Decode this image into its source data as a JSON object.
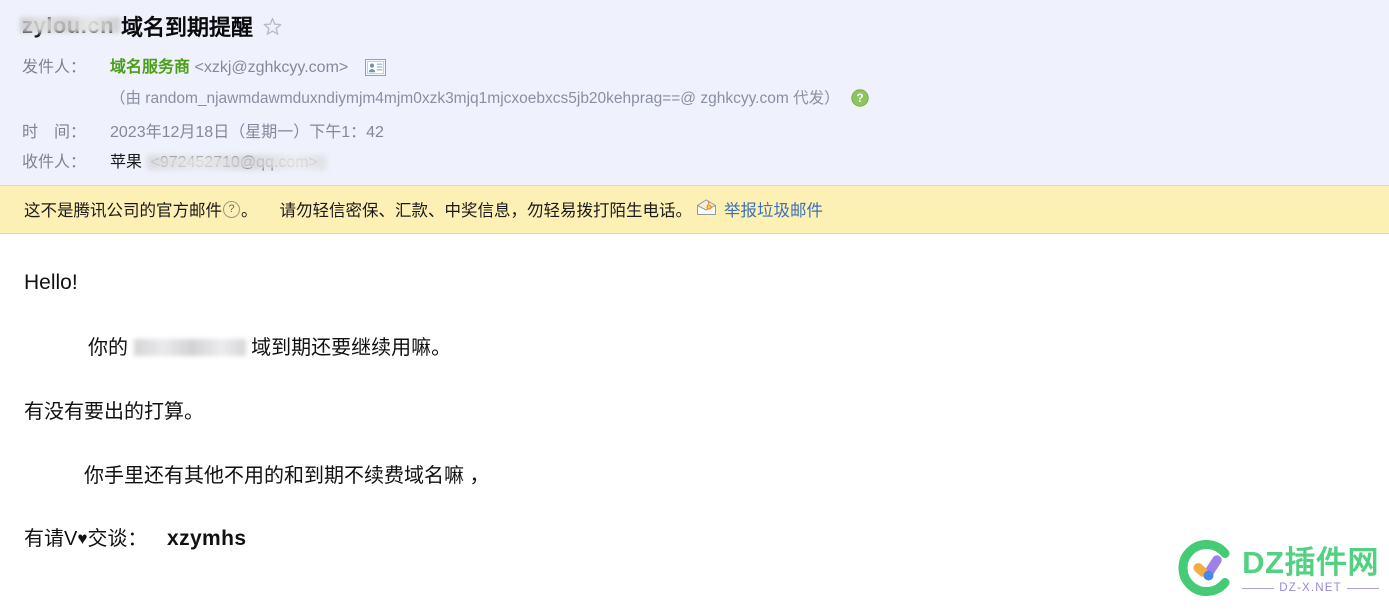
{
  "header": {
    "subject_redacted": "zylou.cn",
    "subject_text": "域名到期提醒",
    "star_icon": "star-outline-icon",
    "labels": {
      "from": "发件人：",
      "time": "时　间：",
      "to": "收件人："
    },
    "sender": {
      "display_name": "域名服务商",
      "address": "<xzkj@zghkcyy.com>",
      "contact_icon": "contact-card-icon"
    },
    "delegate": {
      "text": "（由 random_njawmdawmduxndiymjm4mjm0xzk3mjq1mjcxoebxcs5jb20kehprag==@ zghkcyy.com 代发）",
      "help_icon": "green-question-help-icon"
    },
    "time_value": "2023年12月18日（星期一）下午1：42",
    "recipient": {
      "name": "苹果",
      "address_redacted": "<972452710@qq.com>"
    }
  },
  "warning": {
    "text_before_q": "这不是腾讯公司的官方邮件",
    "q_mark": "?",
    "text_after_q": "。",
    "advice": "请勿轻信密保、汇款、中奖信息，勿轻易拨打陌生电话。",
    "spam_icon": "spam-mail-flame-icon",
    "report_link": "举报垃圾邮件"
  },
  "body": {
    "greeting": "Hello!",
    "line1_prefix": "你的",
    "line1_redacted": "zylou.cn",
    "line1_suffix": "域到期还要继续用嘛。",
    "line2": "有没有要出的打算。",
    "line3": "你手里还有其他不用的和到期不续费域名嘛 ，",
    "line4_prefix": "有请V",
    "line4_heart": "♥",
    "line4_mid": "交谈：",
    "wechat_id": "xzymhs"
  },
  "watermark": {
    "title": "DZ插件网",
    "subtitle": "DZ-X.NET",
    "logo_icon": "dz-check-circle-logo"
  },
  "colors": {
    "header_bg": "#eff2fd",
    "banner_bg": "#fdf0b4",
    "banner_border": "#e8d98e",
    "sender_green": "#4c9f18",
    "link_blue": "#3f6fb5",
    "watermark_green": "#4cd07d",
    "watermark_purple": "#8f88d8"
  }
}
